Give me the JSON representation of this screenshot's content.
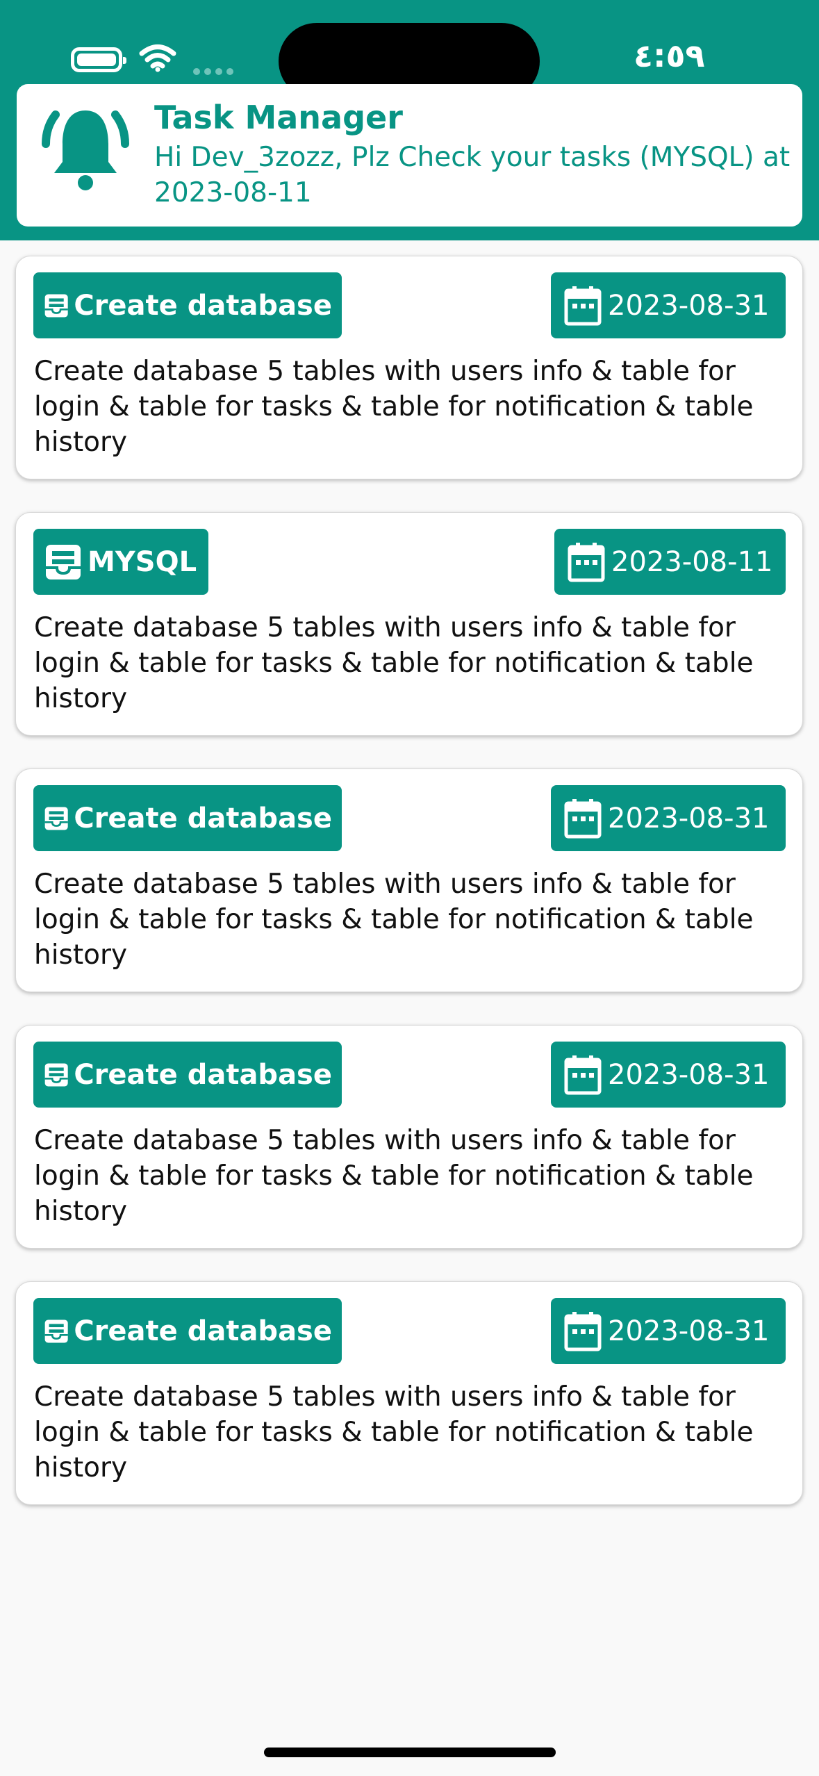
{
  "status_bar": {
    "time": "٤:٥٩"
  },
  "notification": {
    "title": "Task Manager",
    "message": "Hi Dev_3zozz, Plz Check your tasks (MYSQL) at 2023-08-11",
    "icon": "bell-icon"
  },
  "tasks": [
    {
      "title": "Create database",
      "date": "2023-08-31",
      "description": "Create database 5 tables with users info & table for login & table for tasks & table for notification & table history"
    },
    {
      "title": "MYSQL",
      "date": "2023-08-11",
      "description": "Create database 5 tables with users info & table for login & table for tasks & table for notification & table history"
    },
    {
      "title": "Create database",
      "date": "2023-08-31",
      "description": "Create database 5 tables with users info & table for login & table for tasks & table for notification & table history"
    },
    {
      "title": "Create database",
      "date": "2023-08-31",
      "description": "Create database 5 tables with users info & table for login & table for tasks & table for notification & table history"
    },
    {
      "title": "Create database",
      "date": "2023-08-31",
      "description": "Create database 5 tables with users info & table for login & table for tasks & table for notification & table history"
    }
  ],
  "colors": {
    "accent": "#089484",
    "background": "#f9f9f9",
    "card": "#ffffff"
  },
  "icons": {
    "task_tag": "inbox-icon",
    "date": "calendar-icon"
  }
}
